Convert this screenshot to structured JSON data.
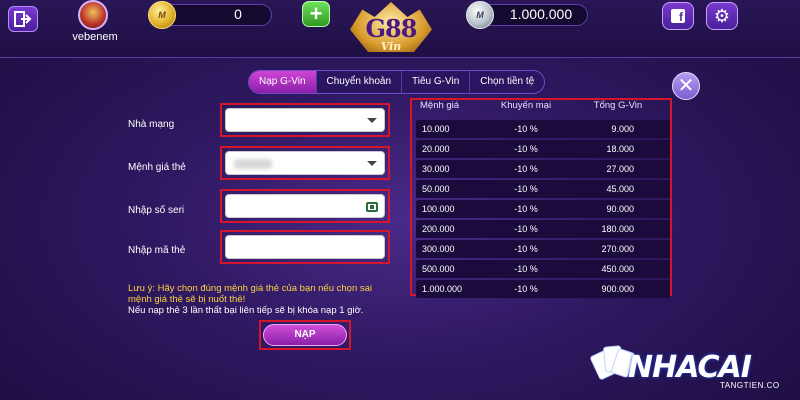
{
  "header": {
    "username": "vebenem",
    "coin_balance": "0",
    "money_balance": "1.000.000",
    "coin_icon_label": "M",
    "silver_icon_label": "M"
  },
  "logo": {
    "main": "G88",
    "sub": "Vin"
  },
  "tabs": [
    {
      "label": "Nạp G-Vin",
      "active": true
    },
    {
      "label": "Chuyển khoản",
      "active": false
    },
    {
      "label": "Tiêu G-Vin",
      "active": false
    },
    {
      "label": "Chọn tiền tệ",
      "active": false
    }
  ],
  "form": {
    "network_label": "Nhà mạng",
    "denomination_label": "Mệnh giá thẻ",
    "serial_label": "Nhập số seri",
    "code_label": "Nhập mã thẻ",
    "network_value": "",
    "serial_value": "",
    "code_value": "",
    "note_warning": "Lưu ý: Hãy chọn đúng mệnh giá thẻ của bạn nếu chọn sai mệnh giá thẻ sẽ bị nuốt thẻ!",
    "note_plain": "Nếu nạp thẻ 3 lần thất bại liên tiếp sẽ bị khóa nạp 1 giờ.",
    "submit_label": "NẠP"
  },
  "rate_table": {
    "headers": [
      "Mệnh giá",
      "Khuyến mại",
      "Tổng G-Vin"
    ],
    "rows": [
      [
        "10.000",
        "-10 %",
        "9.000"
      ],
      [
        "20.000",
        "-10 %",
        "18.000"
      ],
      [
        "30.000",
        "-10 %",
        "27.000"
      ],
      [
        "50.000",
        "-10 %",
        "45.000"
      ],
      [
        "100.000",
        "-10 %",
        "90.000"
      ],
      [
        "200.000",
        "-10 %",
        "180.000"
      ],
      [
        "300.000",
        "-10 %",
        "270.000"
      ],
      [
        "500.000",
        "-10 %",
        "450.000"
      ],
      [
        "1.000.000",
        "-10 %",
        "900.000"
      ]
    ]
  },
  "watermark": {
    "main": "NHACAI",
    "sub": "TANGTIEN.CO"
  },
  "colors": {
    "highlight": "#d4162b",
    "tab_active": "#b030c8",
    "background": "#2e1860"
  }
}
